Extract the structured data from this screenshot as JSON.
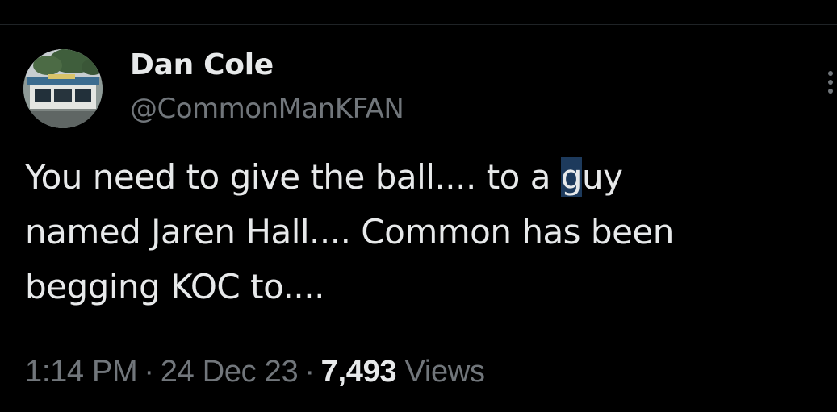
{
  "author": {
    "display_name": "Dan Cole",
    "handle": "@CommonManKFAN"
  },
  "avatar": {
    "icon": "storefront-photo"
  },
  "more_menu": {
    "icon": "more-vertical-icon"
  },
  "tweet": {
    "lines": [
      {
        "before": "You need to give the ball.... to a ",
        "highlight": "g",
        "after": "uy"
      },
      {
        "text": "named Jaren Hall.... Common has been"
      },
      {
        "text": "begging KOC to...."
      }
    ]
  },
  "meta": {
    "time": "1:14 PM",
    "separator": "·",
    "date": "24 Dec 23",
    "views_count": "7,493",
    "views_label": "Views"
  },
  "colors": {
    "background": "#000000",
    "primary_text": "#e7e9ea",
    "secondary_text": "#71767b",
    "selection": "#1d3a5c"
  }
}
